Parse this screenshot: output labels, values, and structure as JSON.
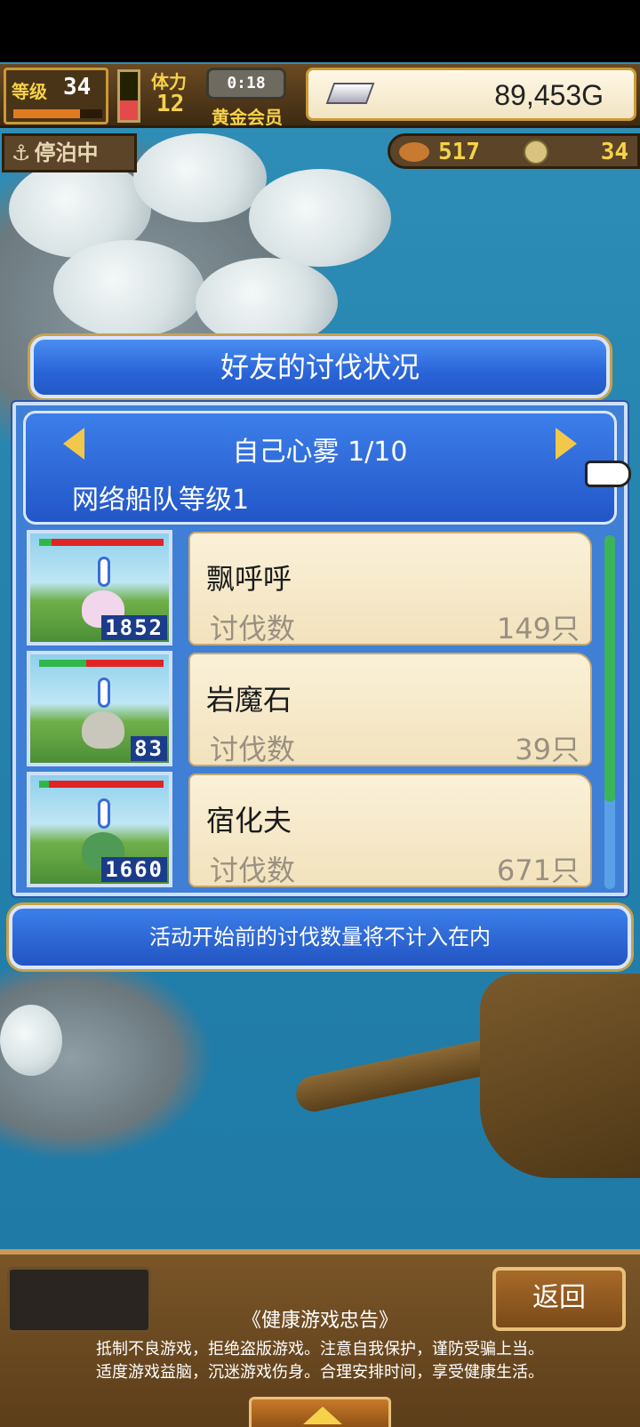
{
  "hud": {
    "level_label": "等级",
    "level_value": "34",
    "level_progress": 0.75,
    "stamina_label": "体力",
    "stamina_value": "12",
    "stamina_fill": 0.4,
    "timer": "0:18",
    "vip_label": "黄金会员",
    "gold": "89,453G",
    "moor_status": "停泊中",
    "food": "517",
    "coins": "34"
  },
  "dialog": {
    "title": "好友的讨伐状况",
    "zone": "自己心雾 1/10",
    "fleet_level": "网络船队等级1",
    "notice": "活动开始前的讨伐数量将不计入在内",
    "rows": [
      {
        "name": "飘呼呼",
        "label": "讨伐数",
        "count": "149只",
        "level": "1852",
        "hp_green": 0.1,
        "monster_color": "#f2d6ec"
      },
      {
        "name": "岩魔石",
        "label": "讨伐数",
        "count": "39只",
        "level": "83",
        "hp_green": 0.38,
        "monster_color": "#c9c6bc"
      },
      {
        "name": "宿化夫",
        "label": "讨伐数",
        "count": "671只",
        "level": "1660",
        "hp_green": 0.08,
        "monster_color": "#4f9a54"
      }
    ]
  },
  "bottom": {
    "back_label": "返回",
    "health_title": "《健康游戏忠告》",
    "health_line1": "抵制不良游戏，拒绝盗版游戏。注意自我保护，谨防受骗上当。",
    "health_line2": "适度游戏益脑，沉迷游戏伤身。合理安排时间，享受健康生活。"
  },
  "colors": {
    "dialog_blue": "#2a64d8",
    "card_bg": "#fbf1d8",
    "hp_red": "#e02424",
    "hp_green": "#2fb84a",
    "accent_gold": "#f5d24a"
  }
}
